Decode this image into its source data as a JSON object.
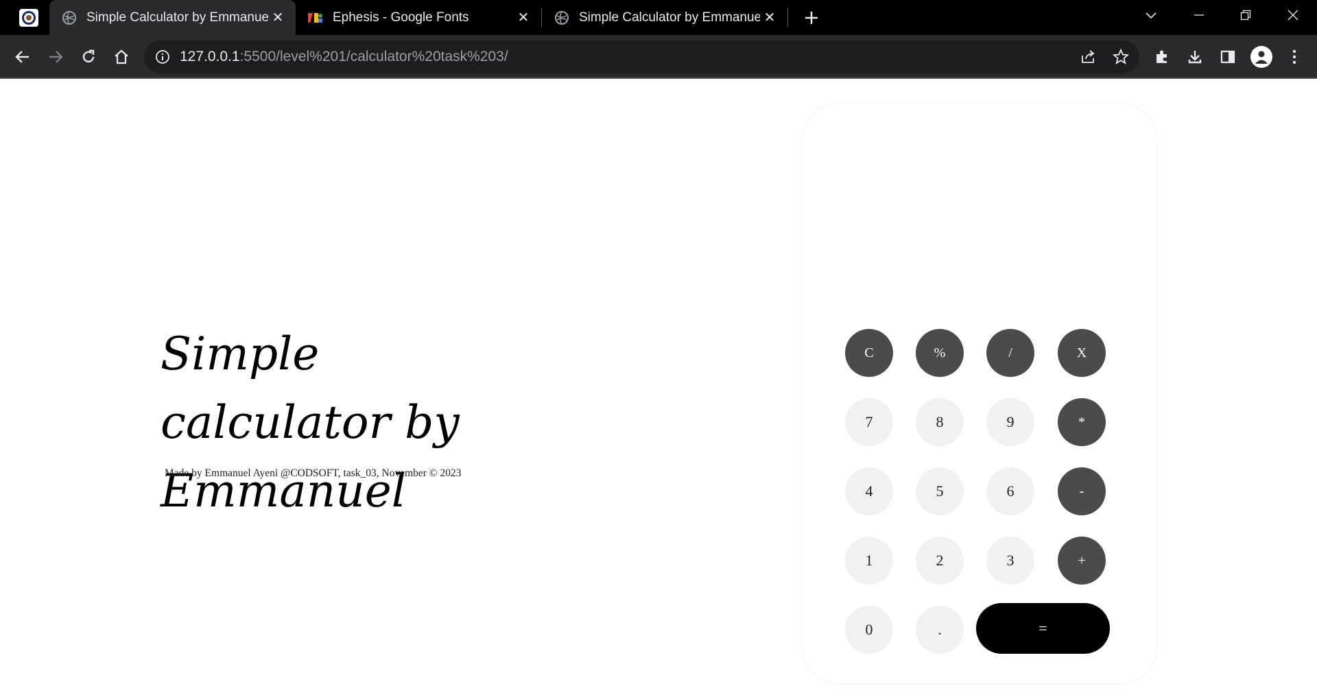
{
  "browser": {
    "tabs": [
      {
        "title": "Simple Calculator by Emmanuel",
        "favicon": "globe-icon",
        "active": true
      },
      {
        "title": "Ephesis - Google Fonts",
        "favicon": "google-fonts-icon",
        "active": false
      },
      {
        "title": "Simple Calculator by Emmanuel",
        "favicon": "globe-icon",
        "active": false
      }
    ],
    "url_host": "127.0.0.1",
    "url_path": ":5500/level%201/calculator%20task%203/"
  },
  "page": {
    "title": "Simple calculator by Emmanuel",
    "credit": "Made by Emmanuel Ayeni @CODSOFT, task_03, November © 2023"
  },
  "calculator": {
    "display": "",
    "keys": {
      "clear": "C",
      "percent": "%",
      "divide": "/",
      "times": "X",
      "seven": "7",
      "eight": "8",
      "nine": "9",
      "multiply": "*",
      "four": "4",
      "five": "5",
      "six": "6",
      "minus": "-",
      "one": "1",
      "two": "2",
      "three": "3",
      "plus": "+",
      "zero": "0",
      "dot": ".",
      "equals": "="
    }
  },
  "colors": {
    "operator_key": "#4b4b4b",
    "number_key": "#f1f1f1",
    "equals_key": "#000000",
    "browser_bg": "#2b2b2d"
  }
}
